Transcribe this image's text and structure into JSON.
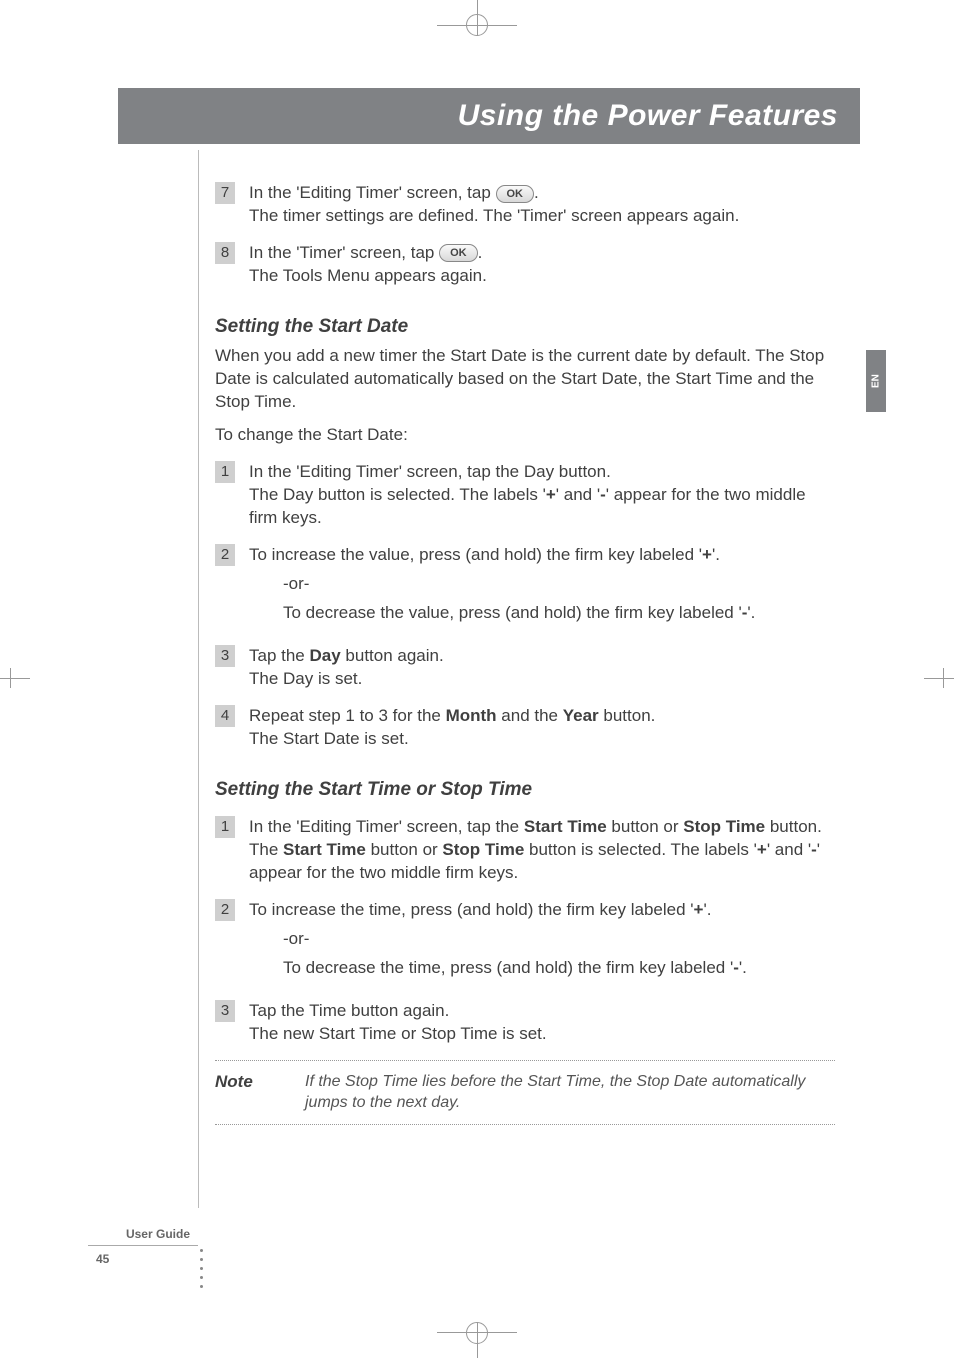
{
  "header": {
    "title": "Using the Power Features",
    "langTab": "EN"
  },
  "icons": {
    "ok": "OK"
  },
  "common": {
    "or": "-or-"
  },
  "section0": {
    "steps": [
      {
        "num": "7",
        "textBefore": "In the 'Editing Timer' screen, tap ",
        "sub": "The timer settings are defined. The 'Timer' screen appears again."
      },
      {
        "num": "8",
        "textBefore": "In the 'Timer' screen, tap ",
        "sub": "The Tools Menu appears again."
      }
    ]
  },
  "section1": {
    "heading": "Setting the Start Date",
    "intro1": "When you add a new timer the Start Date is the current date by default. The Stop Date is calculated automatically based on the Start Date, the Start Time and the Stop Time.",
    "intro2": "To change the Start Date:",
    "steps": [
      {
        "num": "1",
        "line1": "In the 'Editing Timer' screen, tap the Day button.",
        "sub_a": "The Day button is selected. The labels '",
        "sub_b1": "+",
        "sub_c": "' and '",
        "sub_b2": "-",
        "sub_d": "' appear for the two middle firm keys."
      },
      {
        "num": "2",
        "a": "To increase the value, press (and hold) the firm key labeled '",
        "b": "+",
        "c": "'.",
        "alt_a": "To decrease the value, press (and hold) the firm key labeled '",
        "alt_b": "-",
        "alt_c": "'."
      },
      {
        "num": "3",
        "a": "Tap the ",
        "b": "Day",
        "c": " button again.",
        "sub": "The Day is set."
      },
      {
        "num": "4",
        "a": "Repeat step 1 to 3 for the ",
        "b1": "Month",
        "c": " and the ",
        "b2": "Year",
        "d": " button.",
        "sub": "The Start Date is set."
      }
    ]
  },
  "section2": {
    "heading": "Setting the Start Time or Stop Time",
    "steps": [
      {
        "num": "1",
        "a": "In the 'Editing Timer' screen, tap the ",
        "b1": "Start Time",
        "c": " button or ",
        "b2": "Stop Time",
        "d": " button.",
        "sub_a": "The ",
        "sub_b1": "Start Time",
        "sub_c": " button or ",
        "sub_b2": "Stop Time",
        "sub_d": " button is selected. The labels '",
        "sub_b3": "+",
        "sub_e": "' and '",
        "sub_b4": "-",
        "sub_f": "' appear for the two middle firm keys."
      },
      {
        "num": "2",
        "a": "To increase the time, press (and hold) the firm key labeled '",
        "b": "+",
        "c": "'.",
        "alt_a": "To decrease the time, press (and hold) the firm key labeled '",
        "alt_b": "-",
        "alt_c": "'."
      },
      {
        "num": "3",
        "line1": "Tap the Time button again.",
        "sub": "The new Start Time or Stop Time is set."
      }
    ]
  },
  "note": {
    "label": "Note",
    "text": "If the Stop Time lies before the Start Time, the Stop Date automatically jumps to the next day."
  },
  "footer": {
    "guide": "User Guide",
    "page": "45"
  }
}
